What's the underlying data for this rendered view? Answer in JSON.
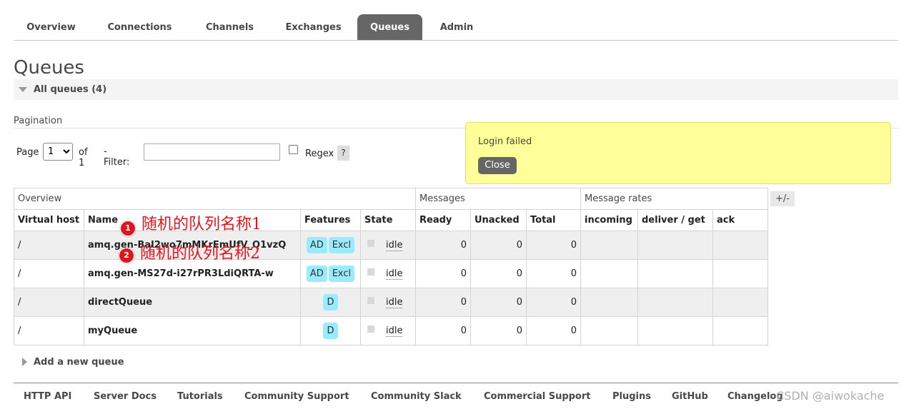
{
  "tabs": [
    {
      "label": "Overview"
    },
    {
      "label": "Connections"
    },
    {
      "label": "Channels"
    },
    {
      "label": "Exchanges"
    },
    {
      "label": "Queues"
    },
    {
      "label": "Admin"
    }
  ],
  "page_title": "Queues",
  "section_label": "All queues (4)",
  "pagination": {
    "label": "Pagination",
    "page_label": "Page",
    "page_value": "1",
    "of_label": "of 1",
    "filter_label": "- Filter:",
    "filter_value": "",
    "regex_label": "Regex",
    "help": "?"
  },
  "login_box": {
    "message": "Login failed",
    "close_label": "Close"
  },
  "table": {
    "groups": [
      "Overview",
      "Messages",
      "Message rates"
    ],
    "plus_minus": "+/-",
    "columns": [
      "Virtual host",
      "Name",
      "Features",
      "State",
      "Ready",
      "Unacked",
      "Total",
      "incoming",
      "deliver / get",
      "ack"
    ],
    "rows": [
      {
        "vhost": "/",
        "name": "amq.gen-BaI2wo7mMKrEmUfV_Q1vzQ",
        "features": [
          "AD",
          "Excl"
        ],
        "state": "idle",
        "ready": "0",
        "unacked": "0",
        "total": "0"
      },
      {
        "vhost": "/",
        "name": "amq.gen-MS27d-i27rPR3LdiQRTA-w",
        "features": [
          "AD",
          "Excl"
        ],
        "state": "idle",
        "ready": "0",
        "unacked": "0",
        "total": "0"
      },
      {
        "vhost": "/",
        "name": "directQueue",
        "features": [
          "D"
        ],
        "state": "idle",
        "ready": "0",
        "unacked": "0",
        "total": "0"
      },
      {
        "vhost": "/",
        "name": "myQueue",
        "features": [
          "D"
        ],
        "state": "idle",
        "ready": "0",
        "unacked": "0",
        "total": "0"
      }
    ]
  },
  "annotations": [
    {
      "number": "1",
      "text": "随机的队列名称1"
    },
    {
      "number": "2",
      "text": "随机的队列名称2"
    }
  ],
  "add_queue_label": "Add a new queue",
  "footer_links": [
    "HTTP API",
    "Server Docs",
    "Tutorials",
    "Community Support",
    "Community Slack",
    "Commercial Support",
    "Plugins",
    "GitHub",
    "Changelog"
  ],
  "watermark": "CSDN @aiwokache",
  "colors": {
    "active_tab": "#666666",
    "badge": "#99ebff",
    "login_box": "#ffff99",
    "annotation": "#e8141c"
  }
}
